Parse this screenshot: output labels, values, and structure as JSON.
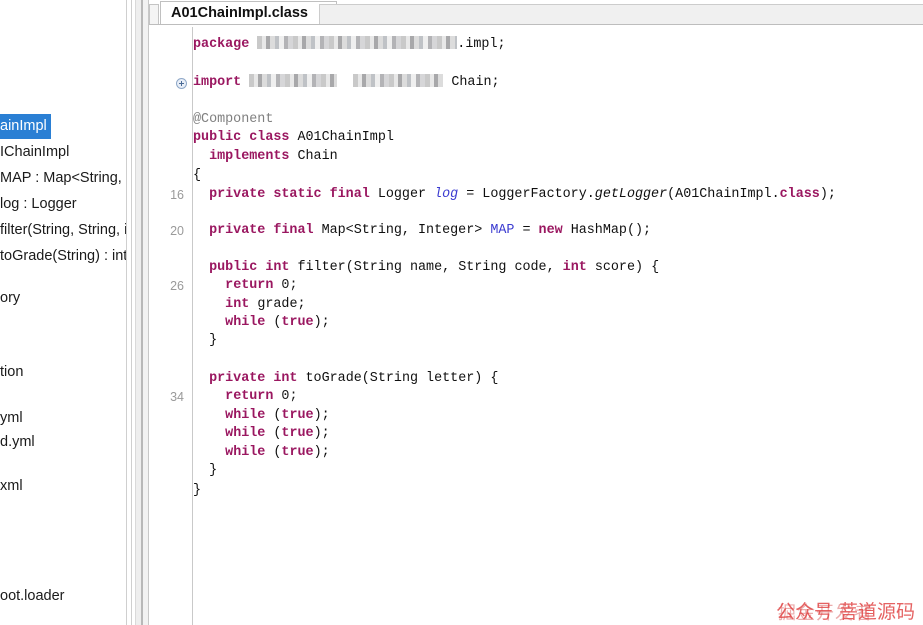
{
  "window": {
    "title": "A01ChainImpl.class"
  },
  "tab_bar": {
    "active_tab": "A01ChainImpl.class",
    "close_glyph": "×"
  },
  "outline": {
    "items": [
      {
        "label": "ainImpl",
        "selected": true
      },
      {
        "label": "IChainImpl",
        "selected": false
      },
      {
        "label": "MAP : Map<String, I",
        "selected": false
      },
      {
        "label": "log : Logger",
        "selected": false
      },
      {
        "label": "filter(String, String, ir",
        "selected": false
      },
      {
        "label": "toGrade(String) : int",
        "selected": false
      },
      {
        "label": "ory",
        "selected": false
      },
      {
        "label": "tion",
        "selected": false
      },
      {
        "label": "yml",
        "selected": false
      },
      {
        "label": "d.yml",
        "selected": false
      },
      {
        "label": "xml",
        "selected": false
      },
      {
        "label": "oot.loader",
        "selected": false
      }
    ]
  },
  "editor": {
    "line_numbers": [
      "16",
      "20",
      "26",
      "34"
    ],
    "fold_icon": "expand-plus",
    "code_lines": [
      {
        "id": "package",
        "segments": [
          {
            "t": "package ",
            "c": "kw"
          },
          {
            "t": "",
            "c": "mosaic-pkg"
          },
          {
            "t": ".impl;",
            "c": "plain"
          }
        ]
      },
      {
        "id": "import",
        "segments": [
          {
            "t": "import ",
            "c": "kw"
          },
          {
            "t": "",
            "c": "mosaic-i1"
          },
          {
            "t": "  ",
            "c": "plain"
          },
          {
            "t": "",
            "c": "mosaic-i2"
          },
          {
            "t": " Chain;",
            "c": "plain"
          }
        ]
      },
      {
        "id": "annotation",
        "segments": [
          {
            "t": "@Component",
            "c": "ann"
          }
        ]
      },
      {
        "id": "class-decl",
        "segments": [
          {
            "t": "public class ",
            "c": "kw"
          },
          {
            "t": "A01ChainImpl",
            "c": "plain"
          }
        ]
      },
      {
        "id": "implements",
        "segments": [
          {
            "t": "  ",
            "c": "plain"
          },
          {
            "t": "implements ",
            "c": "kw"
          },
          {
            "t": "Chain",
            "c": "plain"
          }
        ]
      },
      {
        "id": "open-brace",
        "segments": [
          {
            "t": "{",
            "c": "plain"
          }
        ]
      },
      {
        "id": "logger-field",
        "segments": [
          {
            "t": "  ",
            "c": "plain"
          },
          {
            "t": "private static final ",
            "c": "kw"
          },
          {
            "t": "Logger ",
            "c": "plain"
          },
          {
            "t": "log",
            "c": "ital"
          },
          {
            "t": " = LoggerFactory.",
            "c": "plain"
          },
          {
            "t": "getLogger",
            "c": "itk"
          },
          {
            "t": "(A01ChainImpl.",
            "c": "plain"
          },
          {
            "t": "class",
            "c": "kw"
          },
          {
            "t": ");",
            "c": "plain"
          }
        ]
      },
      {
        "id": "map-field",
        "segments": [
          {
            "t": "  ",
            "c": "plain"
          },
          {
            "t": "private final ",
            "c": "kw"
          },
          {
            "t": "Map<String, Integer> ",
            "c": "plain"
          },
          {
            "t": "MAP",
            "c": "fld"
          },
          {
            "t": " = ",
            "c": "plain"
          },
          {
            "t": "new ",
            "c": "kw"
          },
          {
            "t": "HashMap();",
            "c": "plain"
          }
        ]
      },
      {
        "id": "filter-sig",
        "segments": [
          {
            "t": "  ",
            "c": "plain"
          },
          {
            "t": "public int ",
            "c": "kw"
          },
          {
            "t": "filter(String name, String code, ",
            "c": "plain"
          },
          {
            "t": "int ",
            "c": "kw"
          },
          {
            "t": "score) {",
            "c": "plain"
          }
        ]
      },
      {
        "id": "filter-return",
        "segments": [
          {
            "t": "    ",
            "c": "plain"
          },
          {
            "t": "return ",
            "c": "kw"
          },
          {
            "t": "0;",
            "c": "num"
          }
        ]
      },
      {
        "id": "filter-grade",
        "segments": [
          {
            "t": "    ",
            "c": "plain"
          },
          {
            "t": "int ",
            "c": "kw"
          },
          {
            "t": "grade;",
            "c": "plain"
          }
        ]
      },
      {
        "id": "filter-while",
        "segments": [
          {
            "t": "    ",
            "c": "plain"
          },
          {
            "t": "while ",
            "c": "kw"
          },
          {
            "t": "(",
            "c": "plain"
          },
          {
            "t": "true",
            "c": "kw"
          },
          {
            "t": ");",
            "c": "plain"
          }
        ]
      },
      {
        "id": "filter-close",
        "segments": [
          {
            "t": "  }",
            "c": "plain"
          }
        ]
      },
      {
        "id": "tograde-sig",
        "segments": [
          {
            "t": "  ",
            "c": "plain"
          },
          {
            "t": "private int ",
            "c": "kw"
          },
          {
            "t": "toGrade(String letter) {",
            "c": "plain"
          }
        ]
      },
      {
        "id": "tograde-return",
        "segments": [
          {
            "t": "    ",
            "c": "plain"
          },
          {
            "t": "return ",
            "c": "kw"
          },
          {
            "t": "0;",
            "c": "num"
          }
        ]
      },
      {
        "id": "tograde-while-1",
        "segments": [
          {
            "t": "    ",
            "c": "plain"
          },
          {
            "t": "while ",
            "c": "kw"
          },
          {
            "t": "(",
            "c": "plain"
          },
          {
            "t": "true",
            "c": "kw"
          },
          {
            "t": ");",
            "c": "plain"
          }
        ]
      },
      {
        "id": "tograde-while-2",
        "segments": [
          {
            "t": "    ",
            "c": "plain"
          },
          {
            "t": "while ",
            "c": "kw"
          },
          {
            "t": "(",
            "c": "plain"
          },
          {
            "t": "true",
            "c": "kw"
          },
          {
            "t": ");",
            "c": "plain"
          }
        ]
      },
      {
        "id": "tograde-while-3",
        "segments": [
          {
            "t": "    ",
            "c": "plain"
          },
          {
            "t": "while ",
            "c": "kw"
          },
          {
            "t": "(",
            "c": "plain"
          },
          {
            "t": "true",
            "c": "kw"
          },
          {
            "t": ");",
            "c": "plain"
          }
        ]
      },
      {
        "id": "tograde-close",
        "segments": [
          {
            "t": "  }",
            "c": "plain"
          }
        ]
      },
      {
        "id": "class-close",
        "segments": [
          {
            "t": "}",
            "c": "plain"
          }
        ]
      }
    ]
  },
  "watermark": {
    "primary": "公众号 菩道源码",
    "secondary": "掘金开发者"
  },
  "colors": {
    "keyword": "#9a1760",
    "field": "#3b3bd0",
    "annotation": "#808080",
    "selection": "#2a7fd4",
    "watermark": "#e04848",
    "gutter_text": "#9a9a9a"
  }
}
